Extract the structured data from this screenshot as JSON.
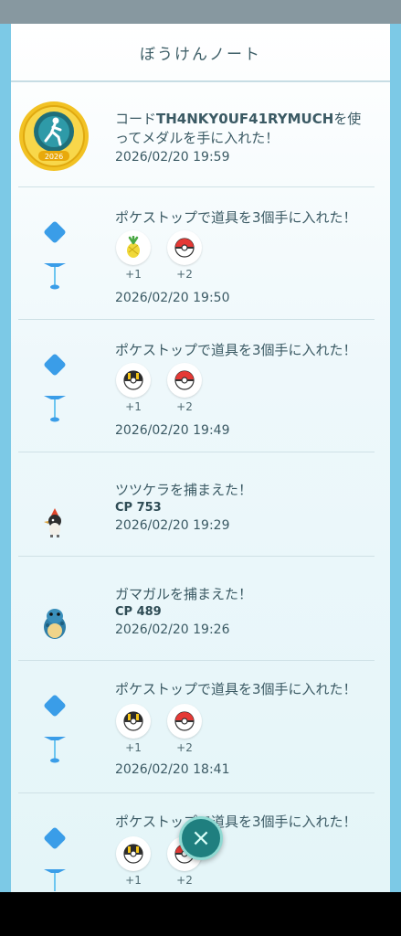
{
  "header": {
    "title": "ぼうけんノート"
  },
  "entries": [
    {
      "type": "medal",
      "message_prefix": "コード",
      "code": "TH4NKY0UF41RYMUCH",
      "message_suffix": "を使ってメダルを手に入れた！",
      "medal_year": "2026",
      "date": "2026/02/20 19:59"
    },
    {
      "type": "pokestop",
      "message": "ポケストップで道具を3個手に入れた！",
      "items": [
        {
          "icon": "pinap-berry-icon",
          "count": "+1"
        },
        {
          "icon": "poke-ball-icon",
          "count": "+2"
        }
      ],
      "date": "2026/02/20 19:50"
    },
    {
      "type": "pokestop",
      "message": "ポケストップで道具を3個手に入れた！",
      "items": [
        {
          "icon": "ultra-ball-icon",
          "count": "+1"
        },
        {
          "icon": "poke-ball-icon",
          "count": "+2"
        }
      ],
      "date": "2026/02/20 19:49"
    },
    {
      "type": "catch",
      "message": "ツツケラを捕まえた！",
      "cp": "CP 753",
      "date": "2026/02/20 19:29"
    },
    {
      "type": "catch",
      "message": "ガマガルを捕まえた！",
      "cp": "CP 489",
      "date": "2026/02/20 19:26"
    },
    {
      "type": "pokestop",
      "message": "ポケストップで道具を3個手に入れた！",
      "items": [
        {
          "icon": "ultra-ball-icon",
          "count": "+1"
        },
        {
          "icon": "poke-ball-icon",
          "count": "+2"
        }
      ],
      "date": "2026/02/20 18:41"
    },
    {
      "type": "pokestop",
      "message": "ポケストップで道具を3個手に入れた！",
      "items": [
        {
          "icon": "ultra-ball-icon",
          "count": "+1"
        },
        {
          "icon": "poke-ball-icon",
          "count": "+2"
        }
      ],
      "date": ""
    }
  ],
  "close_button": {
    "icon": "close-icon",
    "label": "×"
  },
  "colors": {
    "accent": "#1f7f7f",
    "background": "#7cc9e6",
    "text": "#3b5a64"
  }
}
